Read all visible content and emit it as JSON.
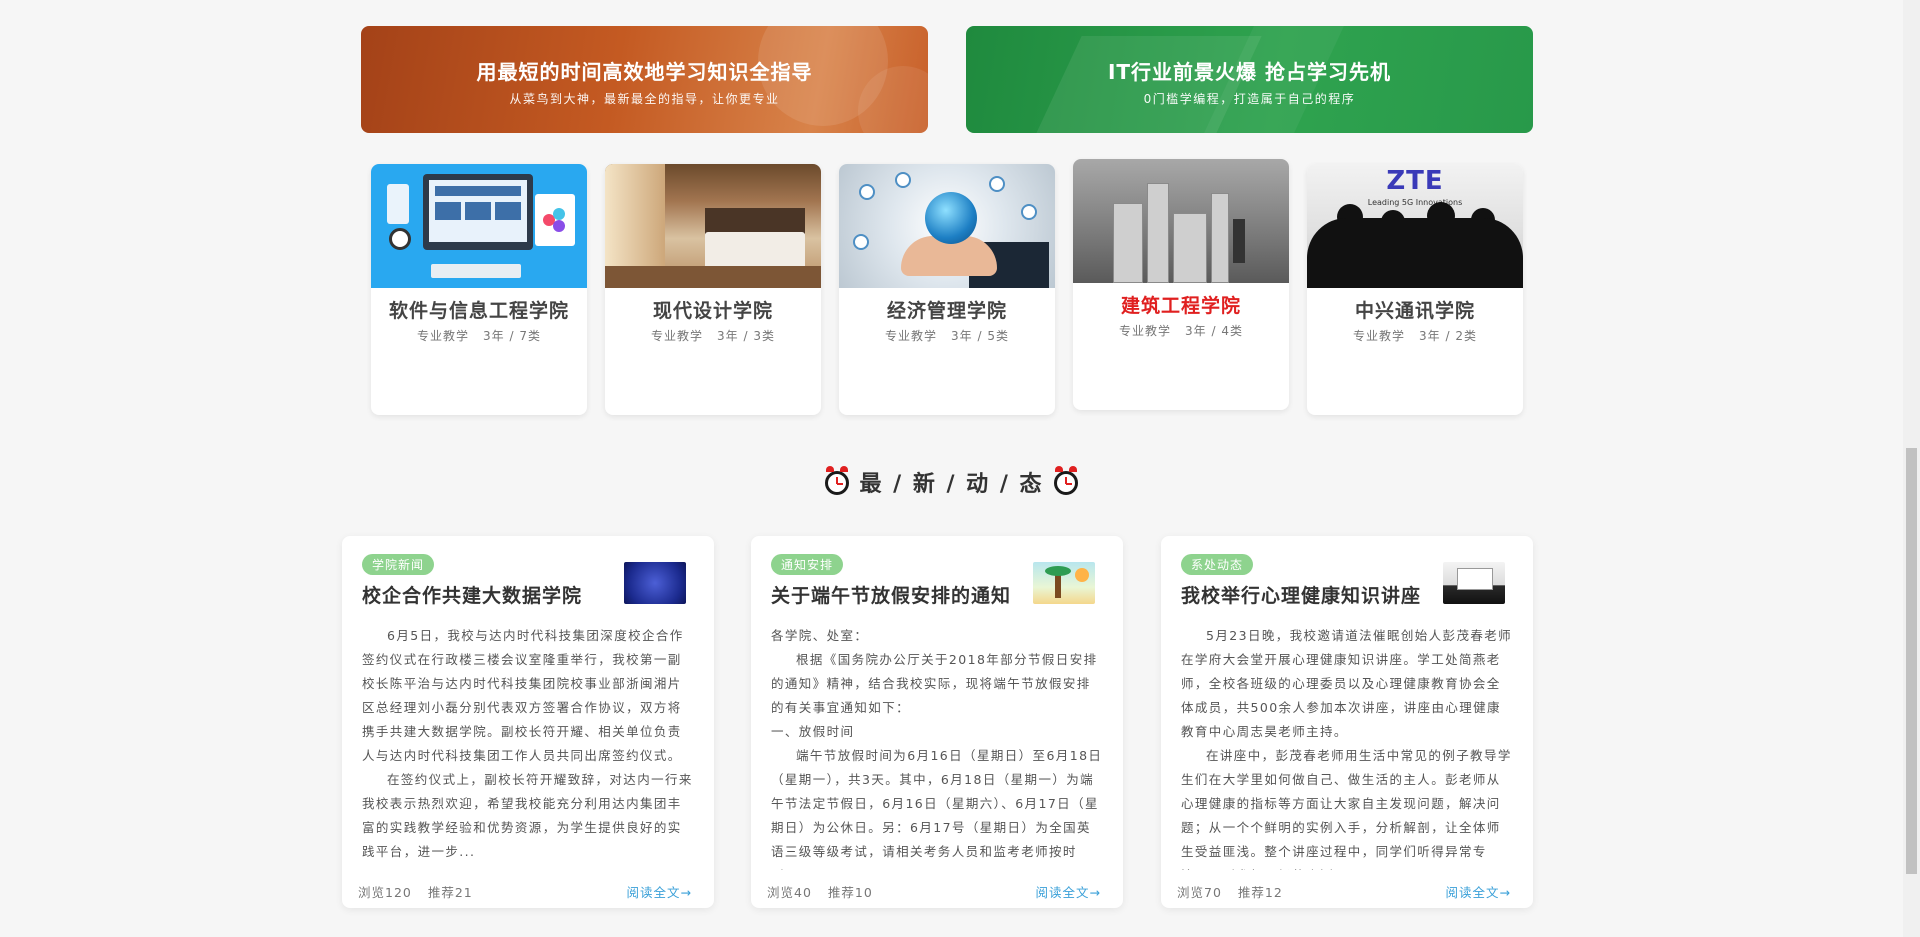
{
  "banners": [
    {
      "title": "用最短的时间高效地学习知识全指导",
      "subtitle": "从菜鸟到大神，最新最全的指导，让你更专业"
    },
    {
      "title": "IT行业前景火爆 抢占学习先机",
      "subtitle": "0门槛学编程，打造属于自己的程序"
    }
  ],
  "colleges": [
    {
      "name": "软件与信息工程学院",
      "type": "专业教学",
      "stats": "3年 / 7类"
    },
    {
      "name": "现代设计学院",
      "type": "专业教学",
      "stats": "3年 / 3类"
    },
    {
      "name": "经济管理学院",
      "type": "专业教学",
      "stats": "3年 / 5类"
    },
    {
      "name": "建筑工程学院",
      "type": "专业教学",
      "stats": "3年 / 4类",
      "highlighted": true
    },
    {
      "name": "中兴通讯学院",
      "type": "专业教学",
      "stats": "3年 / 2类",
      "logo_text": "ZTE",
      "logo_tagline": "Leading 5G Innovations"
    }
  ],
  "news_section": {
    "title": "最 / 新 / 动 / 态"
  },
  "news": [
    {
      "tag": "学院新闻",
      "title": "校企合作共建大数据学院",
      "paragraphs": [
        "6月5日，我校与达内时代科技集团深度校企合作签约仪式在行政楼三楼会议室隆重举行，我校第一副校长陈平治与达内时代科技集团院校事业部浙闽湘片区总经理刘小磊分别代表双方签署合作协议，双方将携手共建大数据学院。副校长符开耀、相关单位负责人与达内时代科技集团工作人员共同出席签约仪式。",
        "在签约仪式上，副校长符开耀致辞，对达内一行来我校表示热烈欢迎，希望我校能充分利用达内集团丰富的实践教学经验和优势资源，为学生提供良好的实践平台，进一步..."
      ],
      "views": "浏览120",
      "recommends": "推荐21",
      "read_more": "阅读全文→"
    },
    {
      "tag": "通知安排",
      "title": "关于端午节放假安排的通知",
      "paragraphs": [
        "各学院、处室：",
        "根据《国务院办公厅关于2018年部分节假日安排的通知》精神，结合我校实际，现将端午节放假安排的有关事宜通知如下：",
        "一、放假时间",
        "端午节放假时间为6月16日（星期日）至6月18日（星期一），共3天。其中，6月18日（星期一）为端午节法定节假日，6月16日（星期六）、6月17日（星期日）为公休日。另：6月17号（星期日）为全国英语三级等级考试，请相关考务人员和监考老师按时到..."
      ],
      "views": "浏览40",
      "recommends": "推荐10",
      "read_more": "阅读全文→"
    },
    {
      "tag": "系处动态",
      "title": "我校举行心理健康知识讲座",
      "paragraphs": [
        "5月23日晚，我校邀请道法催眠创始人彭茂春老师在学府大会堂开展心理健康知识讲座。学工处简燕老师，全校各班级的心理委员以及心理健康教育协会全体成员，共500余人参加本次讲座，讲座由心理健康教育中心周志昊老师主持。",
        "在讲座中，彭茂春老师用生活中常见的例子教导学生们在大学里如何做自己、做生活的主人。彭老师从心理健康的指标等方面让大家自主发现问题，解决问题；从一个个鲜明的实例入手，分析解剖，让全体师生受益匪浅。整个讲座过程中，同学们听得异常专注，踊跃参加现场的小测..."
      ],
      "views": "浏览70",
      "recommends": "推荐12",
      "read_more": "阅读全文→"
    }
  ]
}
